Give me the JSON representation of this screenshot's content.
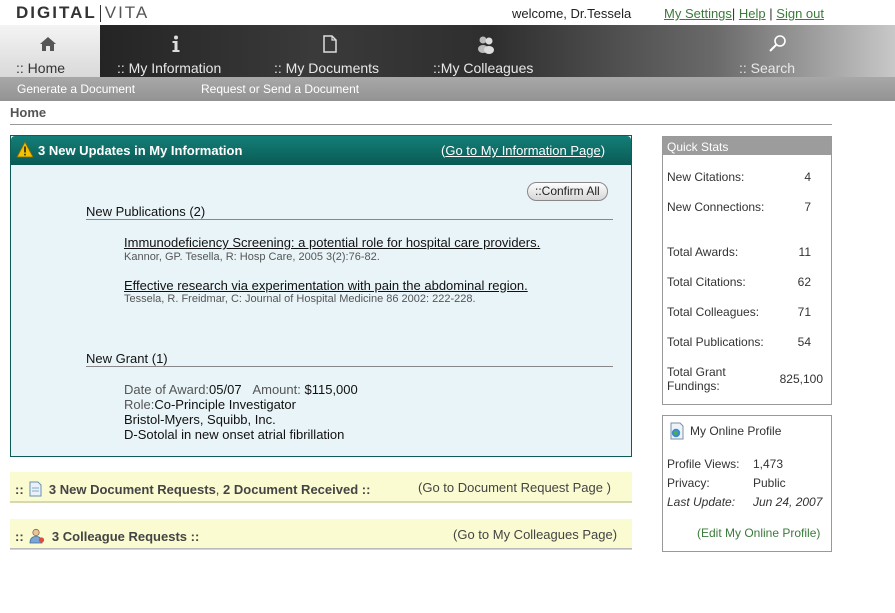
{
  "header": {
    "logo_left": "DIGITAL",
    "logo_right": "VITA",
    "welcome": "welcome, Dr.Tessela",
    "links": [
      "My Settings",
      "Help",
      "Sign out"
    ]
  },
  "nav": {
    "tabs": [
      {
        "label": ":: Home",
        "icon": "house-icon",
        "active": true
      },
      {
        "label": ":: My Information",
        "icon": "info-icon"
      },
      {
        "label": ":: My Documents",
        "icon": "document-icon"
      },
      {
        "label": "::My Colleagues",
        "icon": "people-icon"
      },
      {
        "label": ":: Search",
        "icon": "magnifier-icon"
      }
    ],
    "subnav": [
      "Generate a Document",
      "Request or Send a Document"
    ]
  },
  "breadcrumb": "Home",
  "updates": {
    "title": "3 New Updates in My Information",
    "link_open": "(",
    "link": "Go to My Information Page",
    "link_close": ")",
    "confirm_all": "::Confirm All",
    "publications": {
      "title": "New Publications (2)",
      "items": [
        {
          "title": "Immunodeficiency Screening: a potential role for hospital care providers.",
          "cite": "Kannor, GP. Tesella, R: Hosp Care, 2005 3(2):76-82."
        },
        {
          "title": "Effective research via experimentation with pain the abdominal region.",
          "cite": "Tessela, R. Freidmar, C: Journal of Hospital Medicine 86 2002: 222-228."
        }
      ]
    },
    "grant": {
      "title": "New Grant (1)",
      "date_label": "Date of Award:",
      "date": "05/07",
      "amount_label": "Amount:",
      "amount": "$115,000",
      "role_label": "Role:",
      "role": "Co-Principle Investigator",
      "sponsor": "Bristol-Myers, Squibb, Inc.",
      "project": "D-Sotolal in new onset atrial fibrillation"
    }
  },
  "doc_requests": {
    "prefix": "::",
    "count_text": "3 New Document Requests",
    "sep": ",",
    "received_text": "2 Document Received ::",
    "link": "(Go to Document Request Page )"
  },
  "colleague_requests": {
    "prefix": "::",
    "text": "3 Colleague Requests ::",
    "link": "(Go to My Colleagues Page)"
  },
  "quick_stats": {
    "title": "Quick Stats",
    "rows": [
      {
        "label": "New Citations:",
        "value": "4"
      },
      {
        "label": "New Connections:",
        "value": "7"
      },
      {
        "label": "Total Awards:",
        "value": "11"
      },
      {
        "label": "Total Citations:",
        "value": "62"
      },
      {
        "label": "Total Colleagues:",
        "value": "71"
      },
      {
        "label": "Total Publications:",
        "value": "54"
      },
      {
        "label": "Total Grant Fundings:",
        "value": "825,100"
      }
    ]
  },
  "profile": {
    "title": "My Online Profile",
    "views_label": "Profile Views:",
    "views": "1,473",
    "privacy_label": "Privacy:",
    "privacy": "Public",
    "update_label": "Last Update:",
    "update": "Jun 24, 2007",
    "edit_link": "(Edit My Online Profile)"
  },
  "colors": {
    "panel_header": "#0d6e68",
    "panel_bg": "#e9f4f8",
    "bar_bg": "#fbfbd2",
    "link_green": "#3b7a3b"
  }
}
